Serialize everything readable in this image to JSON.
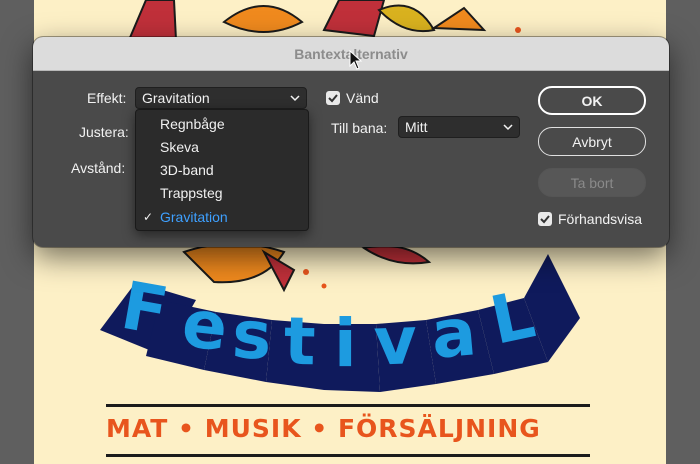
{
  "dialog": {
    "title": "Bantextalternativ",
    "effect_label": "Effekt:",
    "effect_value": "Gravitation",
    "align_label": "Justera:",
    "spacing_label": "Avstånd:",
    "flip_label": "Vänd",
    "flip_checked": true,
    "to_path_label": "Till bana:",
    "to_path_value": "Mitt",
    "ok_label": "OK",
    "cancel_label": "Avbryt",
    "delete_label": "Ta bort",
    "preview_label": "Förhandsvisa",
    "preview_checked": true
  },
  "effect_menu": {
    "items": [
      {
        "label": "Regnbåge",
        "selected": false
      },
      {
        "label": "Skeva",
        "selected": false
      },
      {
        "label": "3D-band",
        "selected": false
      },
      {
        "label": "Trappsteg",
        "selected": false
      },
      {
        "label": "Gravitation",
        "selected": true
      }
    ]
  },
  "poster": {
    "banner_letters": [
      "F",
      "e",
      "s",
      "t",
      "i",
      "v",
      "a",
      "L"
    ],
    "subtitle": "MAT • MUSIK • FÖRSÄLJNING",
    "colors": {
      "background": "#fdf0c6",
      "banner": "#0f1a5c",
      "letters": "#1d9be0",
      "subtitle": "#e8551d",
      "leaf_red": "#c0303a",
      "leaf_orange": "#f08a1e"
    }
  },
  "colors": {
    "dialog_bg": "#4a4a4a",
    "titlebar_bg": "#dcdcdc",
    "accent_selected": "#3ea0ff"
  }
}
